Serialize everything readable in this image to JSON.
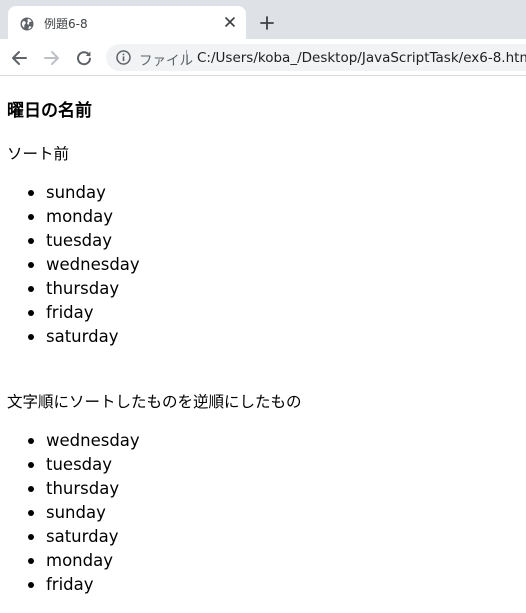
{
  "browser": {
    "tab": {
      "title": "例題6-8",
      "favicon": "globe-icon",
      "close_icon": "close-icon"
    },
    "new_tab_icon": "plus-icon",
    "toolbar": {
      "back_icon": "arrow-left-icon",
      "forward_icon": "arrow-right-icon",
      "reload_icon": "reload-icon",
      "info_icon": "info-icon",
      "site_label": "ファイル",
      "url": "C:/Users/koba_/Desktop/JavaScriptTask/ex6-8.html"
    },
    "colors": {
      "tabstrip": "#dee1e6",
      "omnibox": "#f1f3f4",
      "icon": "#5f6368"
    }
  },
  "page": {
    "heading": "曜日の名前",
    "before_label": "ソート前",
    "before_list": [
      "sunday",
      "monday",
      "tuesday",
      "wednesday",
      "thursday",
      "friday",
      "saturday"
    ],
    "after_label": "文字順にソートしたものを逆順にしたもの",
    "after_list": [
      "wednesday",
      "tuesday",
      "thursday",
      "sunday",
      "saturday",
      "monday",
      "friday"
    ]
  }
}
